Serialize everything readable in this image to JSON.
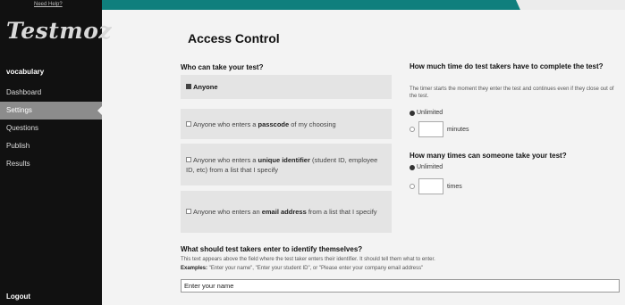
{
  "sidebar": {
    "need_help": "Need Help?",
    "logo": "Testmoz",
    "test_name": "vocabulary",
    "nav": [
      {
        "label": "Dashboard"
      },
      {
        "label": "Settings"
      },
      {
        "label": "Questions"
      },
      {
        "label": "Publish"
      },
      {
        "label": "Results"
      }
    ],
    "logout": "Logout"
  },
  "main": {
    "title": "Access Control",
    "who": {
      "heading": "Who can take your test?",
      "options": [
        {
          "pre": "Anyone",
          "bold": "",
          "post": "",
          "selected": true
        },
        {
          "pre": "Anyone who enters a ",
          "bold": "passcode",
          "post": " of my choosing",
          "selected": false
        },
        {
          "pre": "Anyone who enters a ",
          "bold": "unique identifier",
          "post": " (student ID, employee ID, etc) from a list that I specify",
          "selected": false
        },
        {
          "pre": "Anyone who enters an ",
          "bold": "email address",
          "post": " from a list that I specify",
          "selected": false
        }
      ]
    },
    "time": {
      "heading": "How much time do test takers have to complete the test?",
      "help": "The timer starts the moment they enter the test and continues even if they close out of the test.",
      "option_unlimited": "Unlimited",
      "unit": "minutes"
    },
    "attempts": {
      "heading": "How many times can someone take your test?",
      "option_unlimited": "Unlimited",
      "unit": "times"
    },
    "identify": {
      "heading": "What should test takers enter to identify themselves?",
      "help": "This text appears above the field where the test taker enters their identifier. It should tell them what to enter.",
      "examples_label": "Examples:",
      "examples": " \"Enter your name\", \"Enter your student ID\", or \"Please enter your company email address\"",
      "value": "Enter your name"
    }
  }
}
